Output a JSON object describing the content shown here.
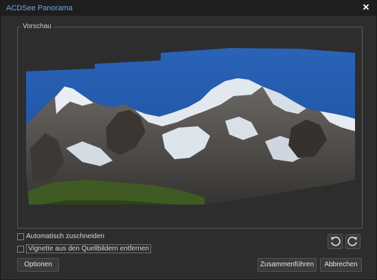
{
  "window": {
    "title": "ACDSee Panorama",
    "close_glyph": "✕"
  },
  "preview_group": {
    "label": "Vorschau",
    "image_description_icon": "panorama-image"
  },
  "options": {
    "auto_crop_label": "Automatisch zuschneiden",
    "auto_crop_checked": false,
    "vignette_label": "Vignette aus den Quellbildern entfernen",
    "vignette_checked": false
  },
  "buttons": {
    "options_label": "Optionen",
    "merge_label": "Zusammenführen",
    "cancel_label": "Abbrechen"
  },
  "icons": {
    "rotate_left": "rotate-left-icon",
    "rotate_right": "rotate-right-icon"
  },
  "colors": {
    "title": "#6fa8dc",
    "sky": "#1d4f9c",
    "background": "#2d2d2d"
  }
}
